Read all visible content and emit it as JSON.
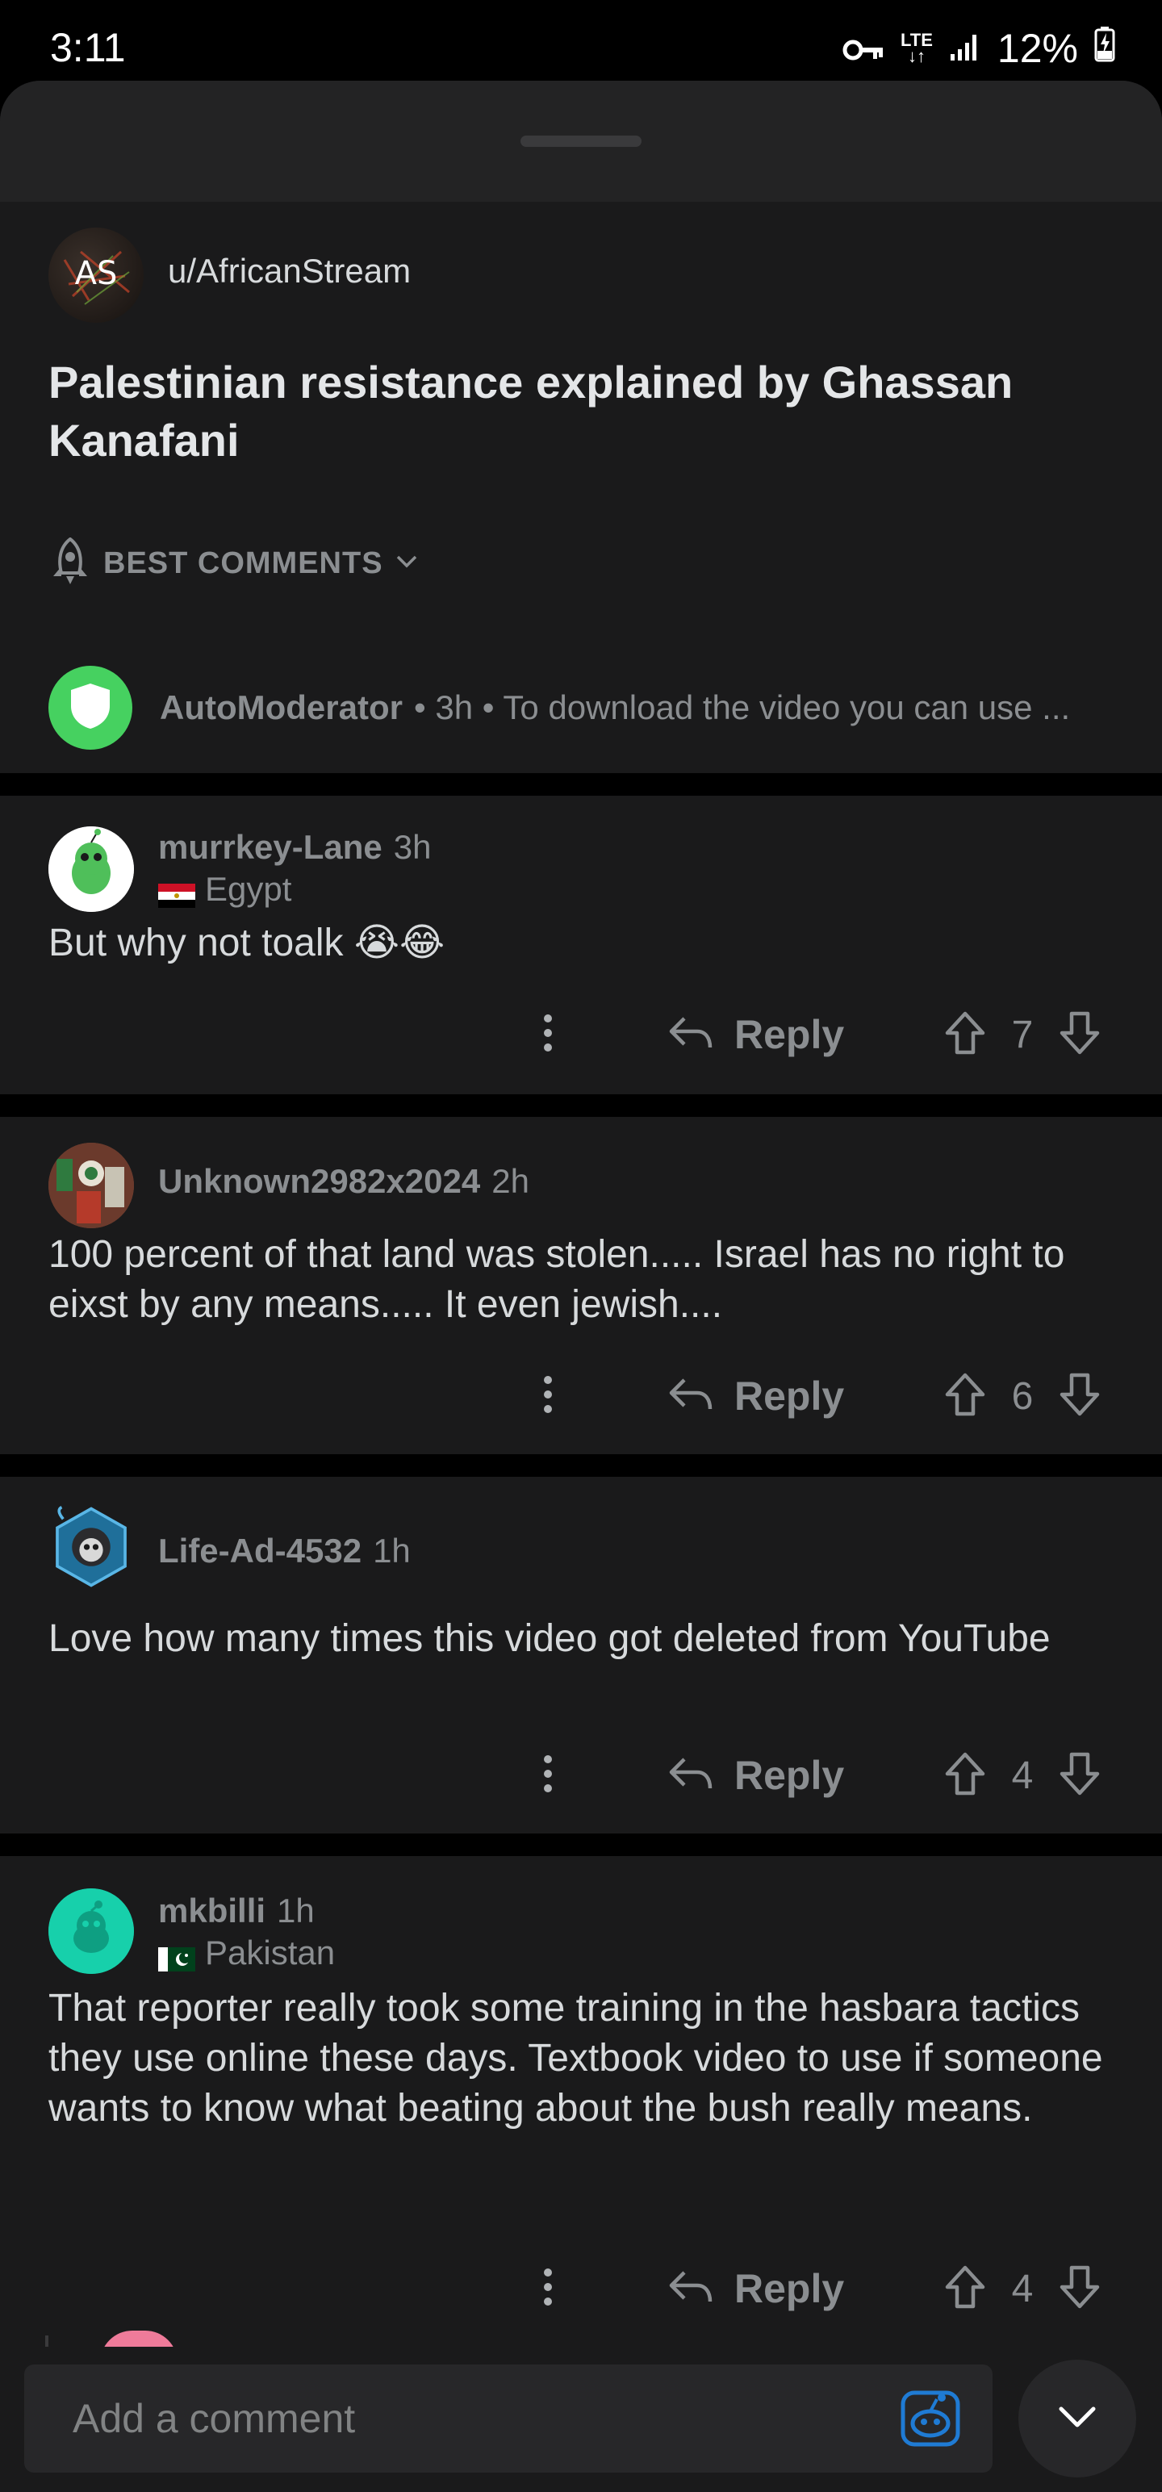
{
  "status_bar": {
    "time": "3:11",
    "network": "LTE",
    "battery": "12%",
    "icons": [
      "vpn-key-icon",
      "lte-data-icon",
      "signal-icon",
      "battery-charging-icon"
    ]
  },
  "post": {
    "author": "u/AfricanStream",
    "avatar_text": "AS",
    "title": "Palestinian resistance explained by Ghassan Kanafani"
  },
  "sort": {
    "label": "BEST COMMENTS"
  },
  "automod": {
    "name": "AutoModerator",
    "meta": "• 3h • To download the video you can use ..."
  },
  "comments": [
    {
      "username": "murrkey-Lane",
      "age": "3h",
      "flair": "Egypt",
      "text": "But why not toalk 😭😂",
      "reply_label": "Reply",
      "votes": "7"
    },
    {
      "username": "Unknown2982x2024",
      "age": "2h",
      "flair": "",
      "text": "100 percent of that land was stolen..... Israel has no right to eixst by any means..... It even jewish....",
      "reply_label": "Reply",
      "votes": "6"
    },
    {
      "username": "Life-Ad-4532",
      "age": "1h",
      "flair": "",
      "text": "Love how many times this video got deleted from YouTube",
      "reply_label": "Reply",
      "votes": "4"
    },
    {
      "username": "mkbilli",
      "age": "1h",
      "flair": "Pakistan",
      "text": "That reporter really took some training in the hasbara tactics they use online these days. Textbook video to use if someone wants to know what beating about the bush really means.",
      "reply_label": "Reply",
      "votes": "4"
    }
  ],
  "composer": {
    "placeholder": "Add a comment"
  },
  "colors": {
    "background": "#1a1a1b",
    "text": "#d7dadc",
    "muted": "#8b8e91",
    "automod_green": "#46d160",
    "snoo_blue": "#1f7bd4"
  }
}
